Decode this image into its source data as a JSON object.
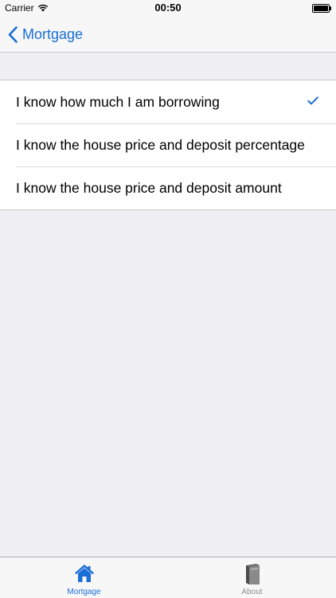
{
  "status_bar": {
    "carrier": "Carrier",
    "time": "00:50",
    "battery_level": 1.0
  },
  "nav": {
    "back_label": "Mortgage",
    "back_icon": "chevron-left-icon",
    "tint_color": "#1a6ed8"
  },
  "options": [
    {
      "label": "I know how much I am borrowing",
      "selected": true
    },
    {
      "label": "I know the house price and deposit percentage",
      "selected": false
    },
    {
      "label": "I know the house price and deposit amount",
      "selected": false
    }
  ],
  "tab_bar": {
    "tabs": [
      {
        "label": "Mortgage",
        "icon": "house-icon",
        "active": true
      },
      {
        "label": "About",
        "icon": "book-icon",
        "active": false
      }
    ],
    "active_color": "#1a6ed8",
    "inactive_color": "#8e8e93"
  }
}
